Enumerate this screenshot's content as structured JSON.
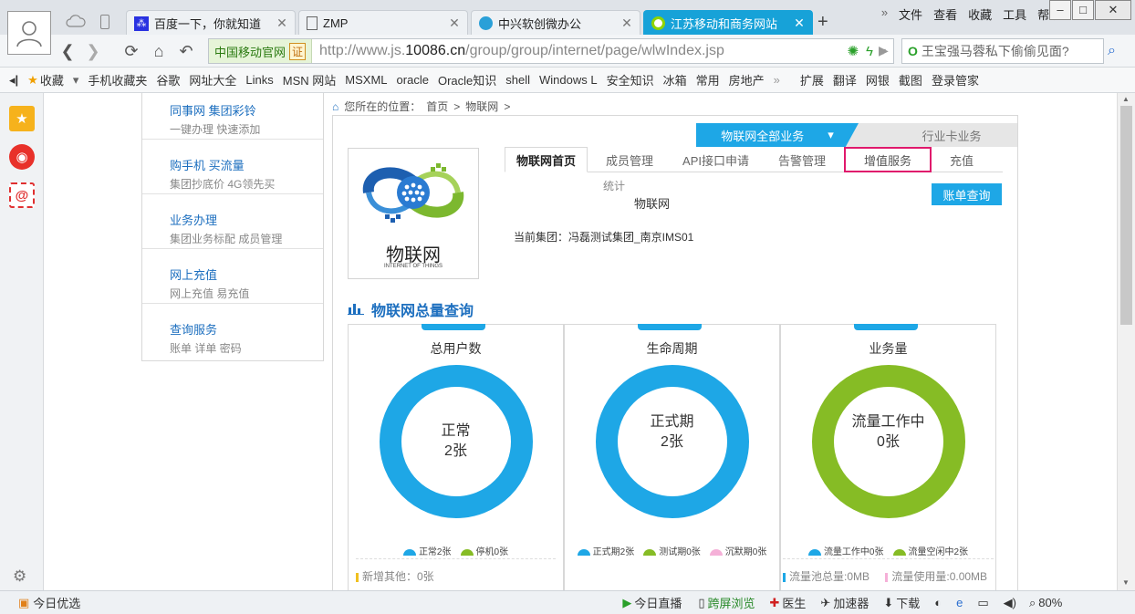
{
  "browser": {
    "tabs": [
      {
        "label": "百度一下，你就知道",
        "icon": "baidu-paw-icon"
      },
      {
        "label": "ZMP",
        "icon": "page-icon"
      },
      {
        "label": "中兴软创微办公",
        "icon": "globe-icon"
      },
      {
        "label": "江苏移动和商务网站",
        "icon": "globe-icon",
        "active": true
      }
    ],
    "menu": [
      "文件",
      "查看",
      "收藏",
      "工具",
      "帮助"
    ],
    "carrier_badge": "中国移动官网",
    "carrier_cert": "证",
    "url_prefix": "http://www.js.",
    "url_domain": "10086.cn",
    "url_path": "/group/group/internet/page/wlwIndex.jsp",
    "search_placeholder": "王宝强马蓉私下偷偷见面?",
    "favorites": [
      "收藏",
      "手机收藏夹",
      "谷歌",
      "网址大全",
      "Links",
      "MSN 网站",
      "MSXML",
      "oracle",
      "Oracle知识",
      "shell",
      "Windows L",
      "安全知识",
      "冰箱",
      "常用",
      "房地产"
    ],
    "fav_tools": [
      "扩展",
      "翻译",
      "网银",
      "截图",
      "登录管家"
    ],
    "status": {
      "left": "今日优选",
      "items": [
        "今日直播",
        "跨屏浏览",
        "医生",
        "加速器",
        "下载"
      ],
      "zoom": "80%"
    }
  },
  "page": {
    "left_menu": [
      {
        "title": "同事网 集团彩铃",
        "sub": "一键办理 快速添加"
      },
      {
        "title": "购手机 买流量",
        "sub": "集团抄底价 4G领先买"
      },
      {
        "title": "业务办理",
        "sub": "集团业务标配 成员管理"
      },
      {
        "title": "网上充值",
        "sub": "网上充值 易充值"
      },
      {
        "title": "查询服务",
        "sub": "账单 详单 密码"
      }
    ],
    "breadcrumb": {
      "prefix": "您所在的位置：",
      "home": "首页",
      "sep": ">",
      "current": "物联网"
    },
    "biz_all": "物联网全部业务",
    "biz_industry": "行业卡业务",
    "logo_cn": "物联网",
    "logo_en": "INTERNET OF THINGS",
    "tabs": [
      "物联网首页",
      "成员管理",
      "API接口申请",
      "告警管理",
      "增值服务",
      "充值"
    ],
    "stat_label": "统计",
    "stat_value": "物联网",
    "bill_button": "账单查询",
    "current_group": "当前集团：冯磊测试集团_南京IMS01",
    "section_title": "物联网总量查询",
    "cards": [
      {
        "title": "总用户数",
        "center_line1": "正常",
        "center_line2": "2张",
        "ring_color": "#1ea7e6",
        "legend": [
          {
            "label": "正常2张",
            "color": "#1ea7e6"
          },
          {
            "label": "停机0张",
            "color": "#86bc25"
          }
        ],
        "footer": [
          {
            "label": "新增其他：0张",
            "color": "#f0c020"
          }
        ]
      },
      {
        "title": "生命周期",
        "center_line1": "正式期",
        "center_line2": "2张",
        "ring_color": "#1ea7e6",
        "legend": [
          {
            "label": "正式期2张",
            "color": "#1ea7e6"
          },
          {
            "label": "测试期0张",
            "color": "#86bc25"
          },
          {
            "label": "沉默期0张",
            "color": "#f5b0d8"
          }
        ],
        "footer": []
      },
      {
        "title": "业务量",
        "center_line1": "流量工作中",
        "center_line2": "0张",
        "ring_color": "#86bc25",
        "legend": [
          {
            "label": "流量工作中0张",
            "color": "#1ea7e6"
          },
          {
            "label": "流量空闲中2张",
            "color": "#86bc25"
          }
        ],
        "footer": [
          {
            "label": "流量池总量:0MB",
            "color": "#1ea7e6"
          },
          {
            "label": "流量使用量:0.00MB",
            "color": "#f5b0d8"
          }
        ]
      }
    ]
  }
}
